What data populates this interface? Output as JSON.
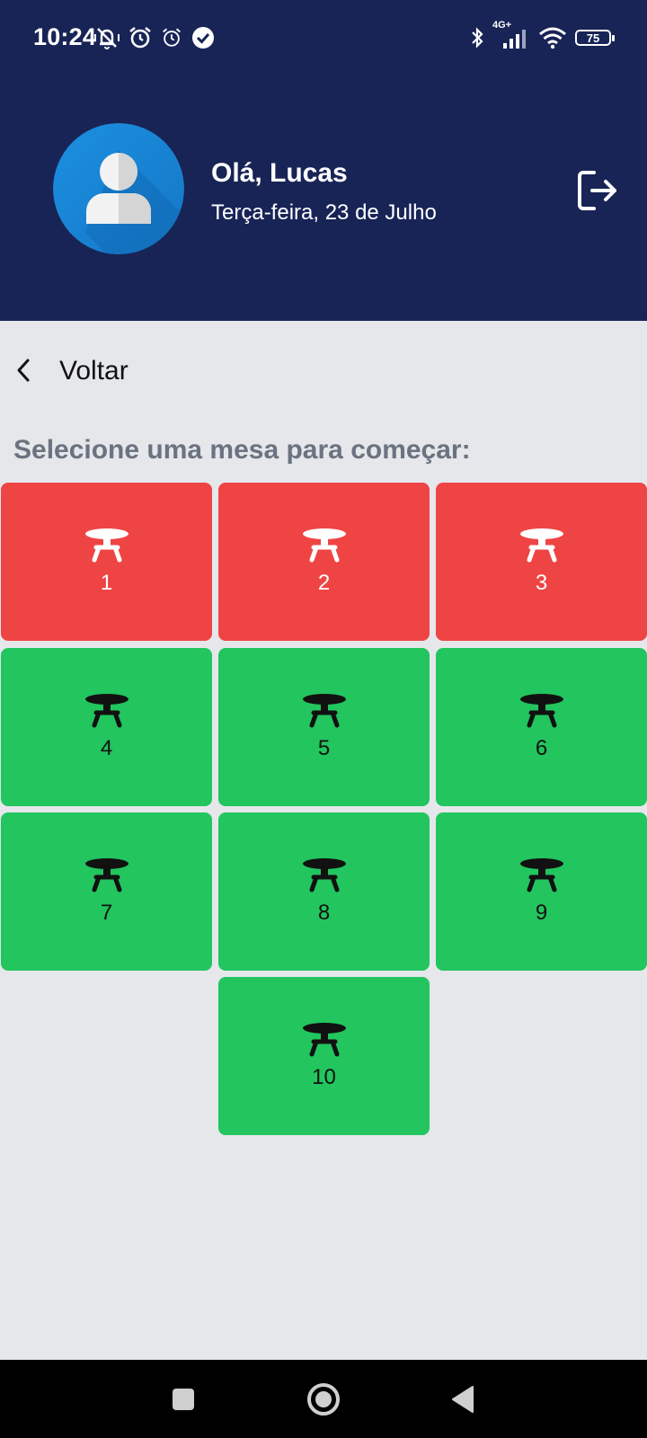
{
  "status_bar": {
    "time": "10:24",
    "network": "4G+",
    "battery": "75"
  },
  "header": {
    "greeting": "Olá, Lucas",
    "date": "Terça-feira, 23 de Julho",
    "avatar_icon": "user-avatar-icon",
    "logout_icon": "logout-icon"
  },
  "nav": {
    "back_label": "Voltar"
  },
  "main": {
    "title": "Selecione uma mesa para começar:",
    "tables": [
      {
        "number": "1",
        "status": "occupied"
      },
      {
        "number": "2",
        "status": "occupied"
      },
      {
        "number": "3",
        "status": "occupied"
      },
      {
        "number": "4",
        "status": "free"
      },
      {
        "number": "5",
        "status": "free"
      },
      {
        "number": "6",
        "status": "free"
      },
      {
        "number": "7",
        "status": "free"
      },
      {
        "number": "8",
        "status": "free"
      },
      {
        "number": "9",
        "status": "free"
      },
      {
        "number": "10",
        "status": "free"
      }
    ]
  },
  "colors": {
    "header_bg": "#182456",
    "page_bg": "#e5e7eb",
    "occupied": "#ef4444",
    "free": "#22c55e",
    "title_text": "#6b7280"
  }
}
